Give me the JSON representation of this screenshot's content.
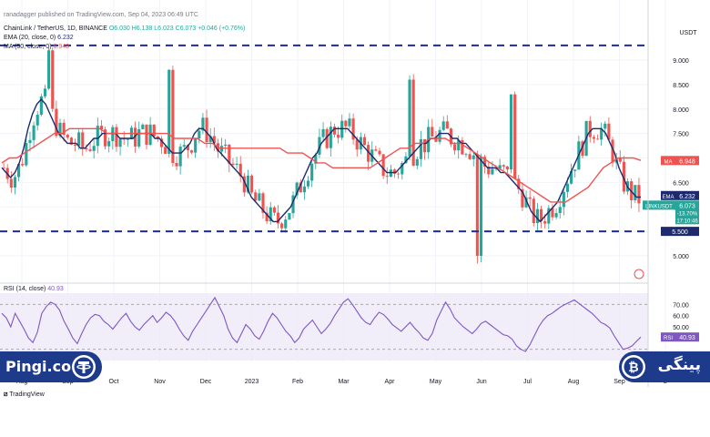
{
  "header": {
    "publisher": "ranadagger published on TradingView.com, Sep 04, 2023 06:49 UTC",
    "symbol": "ChainLink / TetherUS, 1D, BINANCE",
    "o": "O6.030",
    "h": "H6.138",
    "l": "L6.023",
    "c": "C6.073",
    "chg": "+0.046 (+0.76%)",
    "ema_label": "EMA (20, close, 0)",
    "ema_value": "6.232",
    "ma_label": "MA (50, close, 0)",
    "ma_value": "6.948",
    "rsi_label": "RSI (14, close)",
    "rsi_value": "40.93"
  },
  "price_axis": {
    "currency": "USDT",
    "ticks": [
      "9.000",
      "8.500",
      "8.000",
      "7.500",
      "7.000",
      "6.500",
      "6.000",
      "5.500",
      "5.000"
    ]
  },
  "rsi_axis": {
    "ticks": [
      "70.00",
      "60.00",
      "50.00",
      "40.00"
    ]
  },
  "x_axis": {
    "labels": [
      "Aug",
      "Sep",
      "Oct",
      "Nov",
      "Dec",
      "2023",
      "Feb",
      "Mar",
      "Apr",
      "May",
      "Jun",
      "Jul",
      "Aug",
      "Sep",
      "2"
    ]
  },
  "badges": {
    "ma": {
      "tag": "MA",
      "value": "6.948",
      "color": "#ef5350"
    },
    "ema": {
      "tag": "EMA",
      "value": "6.232",
      "color": "#1e2a6e"
    },
    "price": {
      "tag": "LINKUSDT",
      "value": "6.073",
      "change": "-13.70%",
      "countdown": "17:10:46",
      "color": "#26a69a"
    },
    "support": {
      "value": "5.500",
      "color": "#1e2a6e"
    },
    "usdt_top": {
      "value": "USDT"
    },
    "rsi": {
      "tag": "RSI",
      "value": "40.93",
      "color": "#7e57c2"
    }
  },
  "brand": {
    "left": "Pingi.co",
    "right": "پینگی"
  },
  "footer": {
    "tradingview": "TradingView"
  },
  "chart_data": {
    "type": "candlestick",
    "symbol": "LINKUSDT",
    "timeframe": "1D",
    "ylim": [
      4.6,
      9.55
    ],
    "horizontal_levels": [
      9.3,
      5.5
    ],
    "series": [
      {
        "name": "EMA (20, close, 0)",
        "color": "#1e2a6e",
        "values": [
          6.8,
          6.7,
          6.6,
          6.7,
          6.9,
          7.2,
          7.6,
          7.9,
          8.1,
          8.2,
          8.1,
          7.9,
          7.7,
          7.5,
          7.4,
          7.3,
          7.3,
          7.3,
          7.2,
          7.2,
          7.3,
          7.4,
          7.4,
          7.5,
          7.5,
          7.5,
          7.5,
          7.4,
          7.4,
          7.4,
          7.4,
          7.5,
          7.5,
          7.5,
          7.5,
          7.4,
          7.4,
          7.3,
          7.2,
          7.1,
          7.1,
          7.1,
          7.2,
          7.3,
          7.5,
          7.6,
          7.6,
          7.5,
          7.4,
          7.2,
          7.1,
          7.0,
          6.9,
          6.8,
          6.7,
          6.6,
          6.4,
          6.2,
          6.1,
          6.0,
          5.9,
          5.8,
          5.7,
          5.7,
          5.8,
          5.9,
          6.0,
          6.2,
          6.4,
          6.6,
          6.8,
          7.0,
          7.1,
          7.3,
          7.4,
          7.5,
          7.6,
          7.6,
          7.6,
          7.6,
          7.5,
          7.4,
          7.3,
          7.2,
          7.1,
          7.0,
          6.9,
          6.8,
          6.7,
          6.7,
          6.7,
          6.8,
          6.9,
          7.0,
          7.1,
          7.2,
          7.3,
          7.3,
          7.4,
          7.4,
          7.5,
          7.5,
          7.5,
          7.4,
          7.4,
          7.3,
          7.3,
          7.2,
          7.1,
          7.0,
          6.9,
          6.8,
          6.8,
          6.8,
          6.7,
          6.7,
          6.6,
          6.5,
          6.4,
          6.3,
          6.1,
          5.9,
          5.8,
          5.7,
          5.8,
          5.9,
          6.0,
          6.1,
          6.3,
          6.5,
          6.7,
          6.9,
          7.1,
          7.3,
          7.5,
          7.6,
          7.6,
          7.6,
          7.5,
          7.3,
          7.1,
          6.8,
          6.6,
          6.4,
          6.3,
          6.2,
          6.2
        ]
      },
      {
        "name": "MA (50, close, 0)",
        "color": "#ef5350",
        "values": [
          6.9,
          7.0,
          7.0,
          7.1,
          7.2,
          7.3,
          7.4,
          7.5,
          7.5,
          7.6,
          7.6,
          7.6,
          7.6,
          7.6,
          7.5,
          7.5,
          7.5,
          7.5,
          7.5,
          7.5,
          7.5,
          7.5,
          7.5,
          7.4,
          7.4,
          7.4,
          7.4,
          7.3,
          7.3,
          7.2,
          7.2,
          7.2,
          7.2,
          7.2,
          7.2,
          7.2,
          7.2,
          7.2,
          7.1,
          7.1,
          7.1,
          7.0,
          6.9,
          6.9,
          6.8,
          6.8,
          6.8,
          6.8,
          6.8,
          6.8,
          6.9,
          7.0,
          7.1,
          7.2,
          7.2,
          7.3,
          7.3,
          7.4,
          7.4,
          7.4,
          7.3,
          7.3,
          7.2,
          7.1,
          7.0,
          6.9,
          6.8,
          6.7,
          6.6,
          6.5,
          6.4,
          6.3,
          6.2,
          6.1,
          6.1,
          6.1,
          6.2,
          6.3,
          6.4,
          6.6,
          6.8,
          6.9,
          7.0,
          7.0,
          7.0,
          6.95
        ]
      }
    ],
    "rsi": {
      "name": "RSI (14, close)",
      "range": [
        20,
        80
      ],
      "levels": [
        70,
        30
      ],
      "values": [
        62,
        58,
        50,
        62,
        55,
        48,
        40,
        36,
        45,
        62,
        68,
        72,
        70,
        65,
        55,
        48,
        40,
        35,
        44,
        52,
        58,
        61,
        60,
        55,
        52,
        48,
        53,
        58,
        62,
        55,
        50,
        47,
        52,
        56,
        60,
        54,
        58,
        63,
        60,
        55,
        48,
        42,
        38,
        46,
        52,
        58,
        64,
        70,
        76,
        68,
        60,
        48,
        40,
        36,
        44,
        52,
        48,
        42,
        39,
        46,
        55,
        62,
        58,
        52,
        46,
        42,
        36,
        40,
        48,
        52,
        56,
        50,
        44,
        48,
        53,
        60,
        66,
        72,
        75,
        70,
        64,
        58,
        54,
        52,
        58,
        63,
        61,
        57,
        52,
        49,
        46,
        50,
        54,
        49,
        45,
        40,
        38,
        44,
        56,
        64,
        72,
        66,
        58,
        54,
        50,
        47,
        44,
        48,
        53,
        55,
        52,
        49,
        46,
        43,
        42,
        39,
        33,
        30,
        28,
        34,
        42,
        50,
        56,
        60,
        62,
        65,
        68,
        70,
        72,
        74,
        71,
        68,
        65,
        62,
        58,
        54,
        52,
        49,
        42,
        36,
        30,
        31,
        33,
        37,
        40.93
      ]
    },
    "price_last": 6.073
  }
}
